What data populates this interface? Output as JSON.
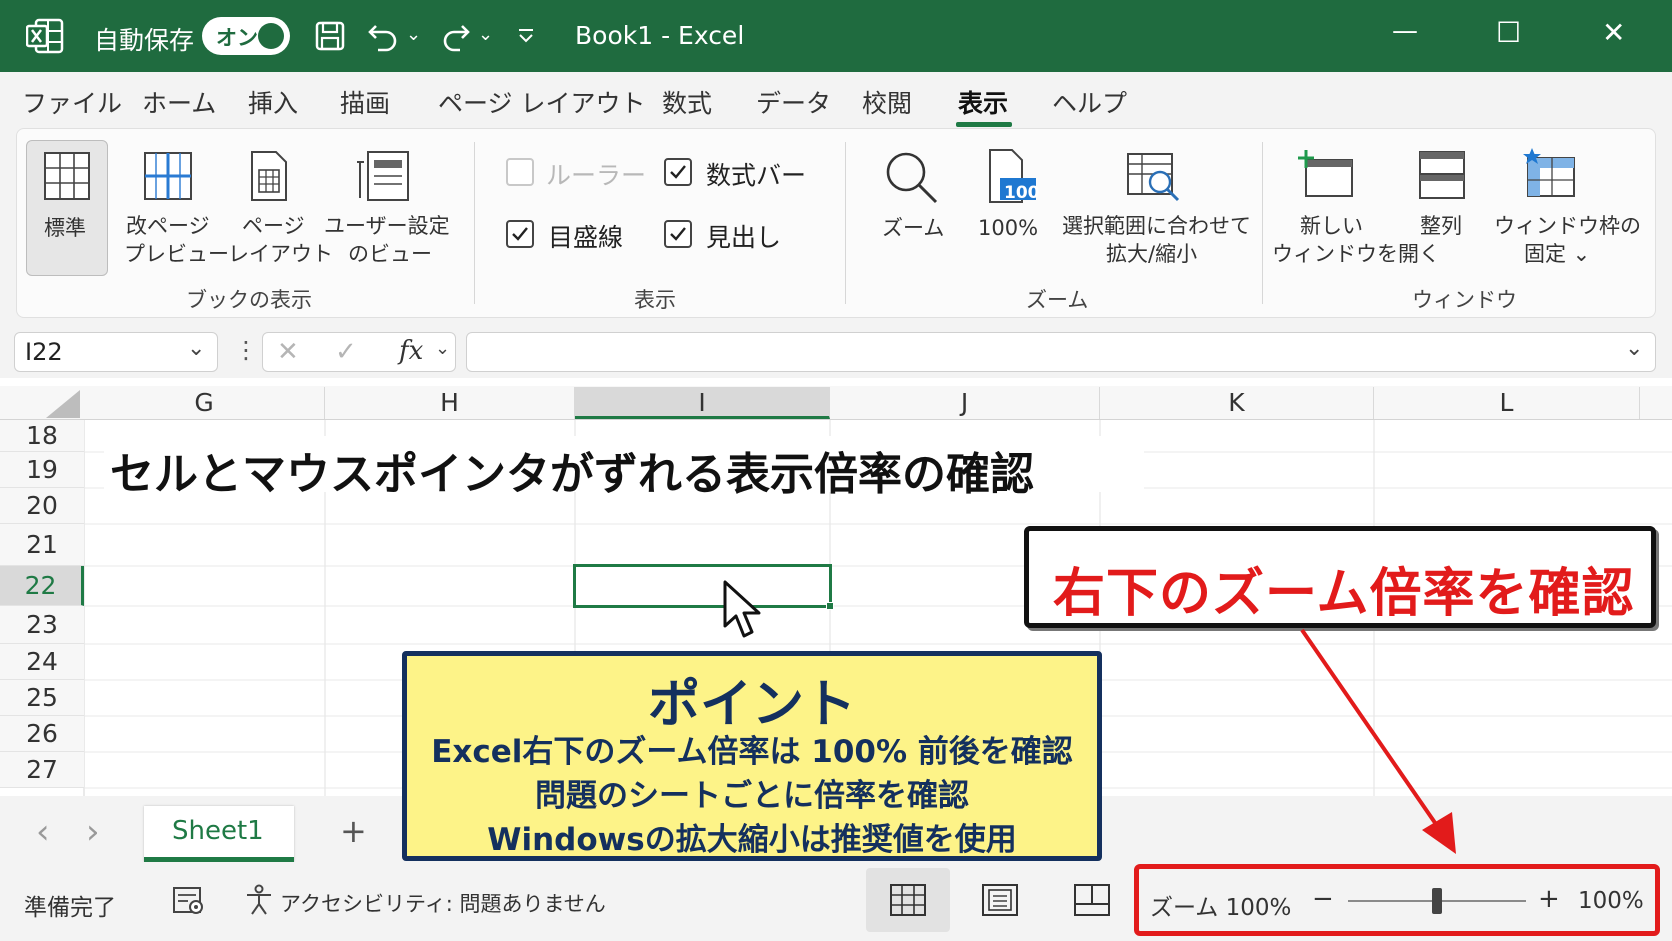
{
  "titlebar": {
    "autosave_label": "自動保存",
    "autosave_state": "オン",
    "doc_title": "Book1  -  Excel",
    "minimize_glyph": "—",
    "maximize_glyph": "☐",
    "close_glyph": "✕"
  },
  "menu": [
    "ファイル",
    "ホーム",
    "挿入",
    "描画",
    "ページ レイアウト",
    "数式",
    "データ",
    "校閲",
    "表示",
    "ヘルプ"
  ],
  "ribbon": {
    "workbook_views": {
      "group": "ブックの表示",
      "normal": "標準",
      "page_break": [
        "改ページ",
        "プレビュー"
      ],
      "page_layout": [
        "ページ",
        "レイアウト"
      ],
      "custom": [
        "ユーザー設定",
        "のビュー"
      ]
    },
    "show": {
      "group": "表示",
      "ruler": "ルーラー",
      "formula_bar": "数式バー",
      "gridlines": "目盛線",
      "headings": "見出し"
    },
    "zoom": {
      "group": "ズーム",
      "zoom": "ズーム",
      "hundred": "100%",
      "hundred_icon_text": "100",
      "selection": [
        "選択範囲に合わせて",
        "拡大/縮小"
      ]
    },
    "window": {
      "group": "ウィンドウ",
      "new_window": [
        "新しい",
        "ウィンドウを開く"
      ],
      "arrange": "整列",
      "freeze": [
        "ウィンドウ枠の",
        "固定 ⌄"
      ]
    }
  },
  "formula_bar": {
    "name_box": "I22",
    "fx": "fx",
    "cancel": "✕",
    "enter": "✓"
  },
  "grid": {
    "columns": [
      "G",
      "H",
      "I",
      "J",
      "K",
      "L"
    ],
    "rows": [
      "18",
      "19",
      "20",
      "21",
      "22",
      "23",
      "24",
      "25",
      "26",
      "27"
    ],
    "heading_text": "セルとマウスポインタがずれる表示倍率の確認"
  },
  "sheet_tabs": {
    "active": "Sheet1",
    "add": "+",
    "prev": "‹",
    "next": "›"
  },
  "status": {
    "ready": "準備完了",
    "accessibility": "アクセシビリティ: 問題ありません",
    "zoom_label": "ズーム 100%",
    "zoom_minus": "−",
    "zoom_plus": "+",
    "zoom_value": "100%",
    "zoom_level_percent": 100
  },
  "annotation": {
    "callout": "右下のズーム倍率を確認",
    "point_title": "ポイント",
    "point_lines": [
      "Excel右下のズーム倍率は 100% 前後を確認",
      "問題のシートごとに倍率を確認",
      "Windowsの拡大縮小は推奨値を使用"
    ]
  },
  "colors": {
    "title_green": "#1f6b3f",
    "accent_green": "#1f7a45",
    "annotation_red": "#e21b1b",
    "point_yellow": "#fdf388",
    "point_navy": "#14305e"
  }
}
